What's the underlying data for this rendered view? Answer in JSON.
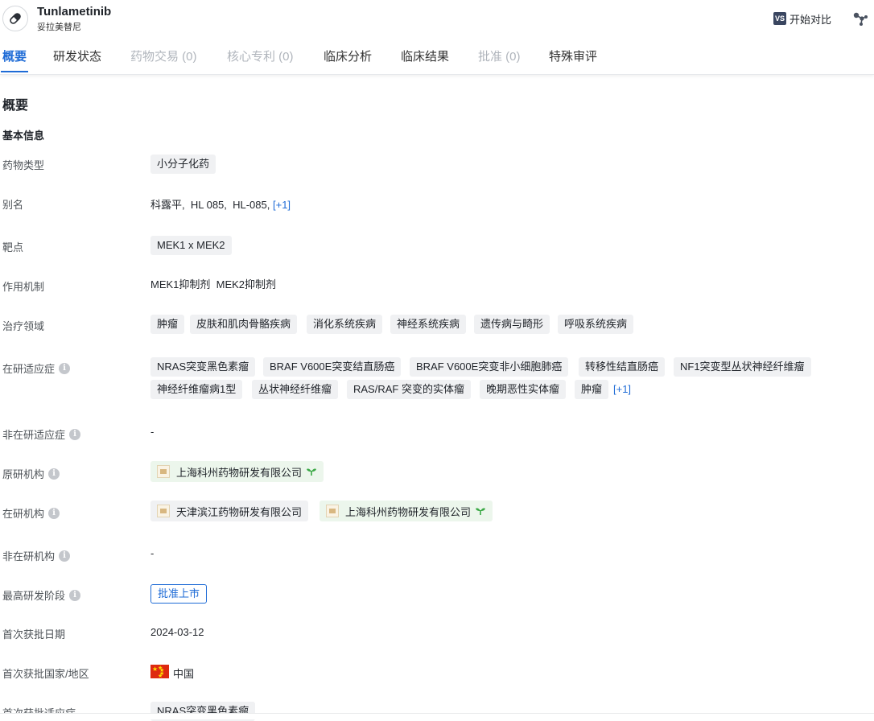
{
  "header": {
    "title": "Tunlametinib",
    "subtitle": "妥拉美替尼",
    "compare_icon": "VS",
    "compare_label": "开始对比"
  },
  "tabs": [
    {
      "label": "概要",
      "state": "active"
    },
    {
      "label": "研发状态",
      "state": "normal"
    },
    {
      "label": "药物交易 (0)",
      "state": "disabled"
    },
    {
      "label": "核心专利 (0)",
      "state": "disabled"
    },
    {
      "label": "临床分析",
      "state": "normal"
    },
    {
      "label": "临床结果",
      "state": "normal"
    },
    {
      "label": "批准 (0)",
      "state": "disabled"
    },
    {
      "label": "特殊审评",
      "state": "normal"
    }
  ],
  "section_title": "概要",
  "basic_info_title": "基本信息",
  "fields": {
    "drug_type": {
      "label": "药物类型",
      "value": "小分子化药"
    },
    "alias": {
      "label": "别名",
      "value": "科露平,  HL 085,  HL-085,",
      "more": "[+1]"
    },
    "target": {
      "label": "靶点",
      "value": "MEK1 x MEK2"
    },
    "mechanism": {
      "label": "作用机制",
      "value": "MEK1抑制剂  MEK2抑制剂"
    },
    "therapeutic_area": {
      "label": "治疗领域",
      "tags": [
        "肿瘤",
        "皮肤和肌肉骨骼疾病",
        "消化系统疾病",
        "神经系统疾病",
        "遗传病与畸形",
        "呼吸系统疾病"
      ]
    },
    "active_indication": {
      "label": "在研适应症",
      "tags_row1": [
        "NRAS突变黑色素瘤",
        "BRAF V600E突变结直肠癌",
        "BRAF V600E突变非小细胞肺癌",
        "转移性结直肠癌",
        "NF1突变型丛状神经纤维瘤"
      ],
      "tags_row2": [
        "神经纤维瘤病1型",
        "丛状神经纤维瘤",
        "RAS/RAF 突变的实体瘤",
        "晚期恶性实体瘤",
        "肿瘤"
      ],
      "more": "[+1]"
    },
    "inactive_indication": {
      "label": "非在研适应症",
      "value": "-"
    },
    "originator": {
      "label": "原研机构",
      "orgs": [
        "上海科州药物研发有限公司"
      ]
    },
    "active_org": {
      "label": "在研机构",
      "orgs": [
        "天津滨江药物研发有限公司",
        "上海科州药物研发有限公司"
      ]
    },
    "inactive_org": {
      "label": "非在研机构",
      "value": "-"
    },
    "highest_phase": {
      "label": "最高研发阶段",
      "value": "批准上市"
    },
    "first_approval_date": {
      "label": "首次获批日期",
      "value": "2024-03-12"
    },
    "first_approval_country": {
      "label": "首次获批国家/地区",
      "value": "中国"
    },
    "first_approval_indication": {
      "label": "首次获批适应症",
      "value": "NRAS突变黑色素瘤"
    }
  },
  "colors": {
    "accent": "#1e6bd6",
    "tag_bg": "#f0f1f3",
    "org_green_bg": "#ecf6ec"
  }
}
